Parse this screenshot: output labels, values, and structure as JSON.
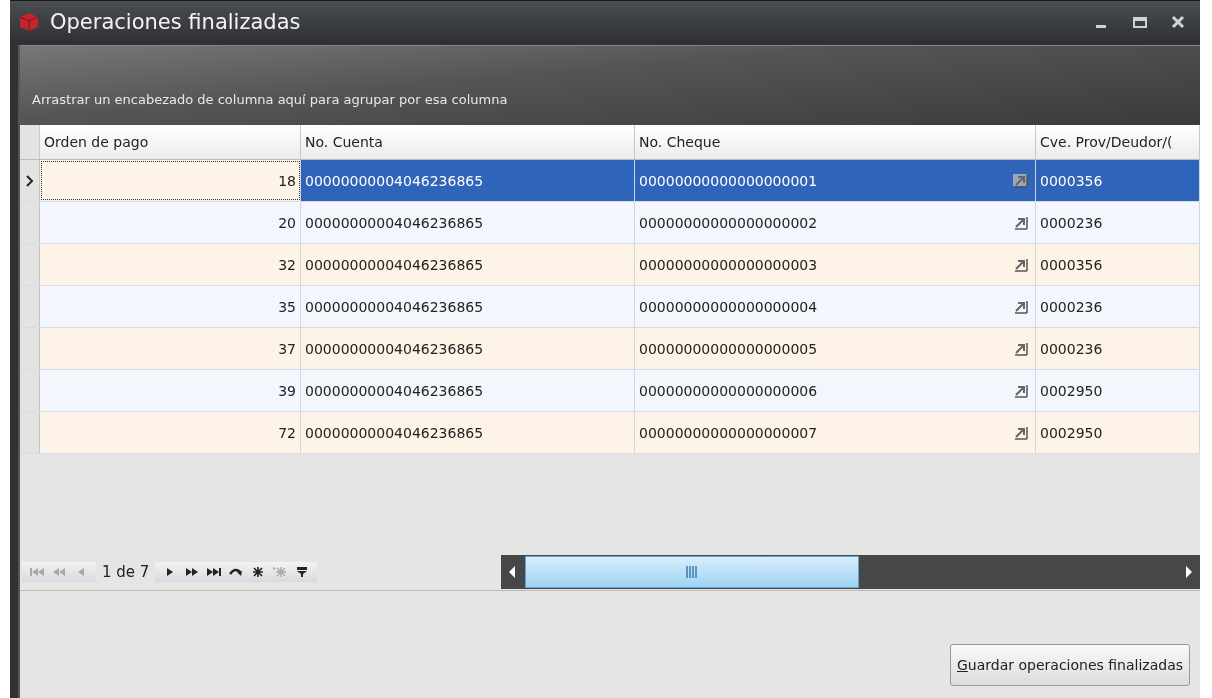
{
  "window": {
    "title": "Operaciones finalizadas"
  },
  "group_panel": {
    "hint": "Arrastrar un encabezado de columna aquí para agrupar por esa columna"
  },
  "table": {
    "columns": [
      "Orden de pago",
      "No. Cuenta",
      "No. Cheque",
      "Cve. Prov/Deudor/("
    ],
    "rows": [
      {
        "selected": true,
        "cells": [
          "18",
          "00000000004046236865",
          "00000000000000000001",
          "0000356"
        ]
      },
      {
        "selected": false,
        "cells": [
          "20",
          "00000000004046236865",
          "00000000000000000002",
          "0000236"
        ]
      },
      {
        "selected": false,
        "cells": [
          "32",
          "00000000004046236865",
          "00000000000000000003",
          "0000356"
        ]
      },
      {
        "selected": false,
        "cells": [
          "35",
          "00000000004046236865",
          "00000000000000000004",
          "0000236"
        ]
      },
      {
        "selected": false,
        "cells": [
          "37",
          "00000000004046236865",
          "00000000000000000005",
          "0000236"
        ]
      },
      {
        "selected": false,
        "cells": [
          "39",
          "00000000004046236865",
          "00000000000000000006",
          "0002950"
        ]
      },
      {
        "selected": false,
        "cells": [
          "72",
          "00000000004046236865",
          "00000000000000000007",
          "0002950"
        ]
      }
    ]
  },
  "pager": {
    "position": "1 de 7",
    "before": [
      {
        "kind": "first",
        "disabled": true
      },
      {
        "kind": "prev-page",
        "disabled": true
      },
      {
        "kind": "prev",
        "disabled": true
      }
    ],
    "after": [
      {
        "kind": "next",
        "disabled": false
      },
      {
        "kind": "next-page",
        "disabled": false
      },
      {
        "kind": "last",
        "disabled": false
      },
      {
        "kind": "refresh",
        "disabled": false
      },
      {
        "kind": "new",
        "disabled": false
      },
      {
        "kind": "new-selected",
        "disabled": true
      },
      {
        "kind": "filter",
        "disabled": false
      }
    ]
  },
  "save_button": {
    "label": "Guardar operaciones finalizadas"
  }
}
